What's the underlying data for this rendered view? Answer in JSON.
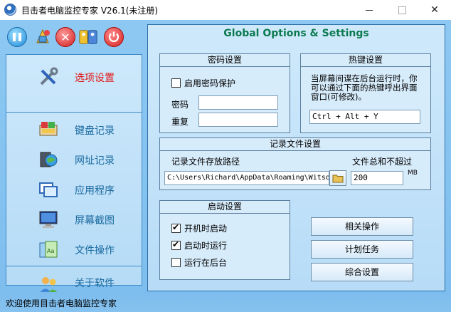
{
  "window": {
    "title": "目击者电脑监控专家 V26.1(未注册)",
    "close_glyph": "✕"
  },
  "toolbar": {
    "buttons": [
      {
        "icon": "pause-icon"
      },
      {
        "icon": "clean-icon"
      },
      {
        "icon": "stop-icon",
        "glyph": "✕"
      },
      {
        "icon": "keys-icon"
      },
      {
        "icon": "power-icon"
      }
    ]
  },
  "sidebar": {
    "items": [
      {
        "label": "选项设置",
        "icon": "tools-icon",
        "active": true
      },
      {
        "label": "键盘记录",
        "icon": "keyboard-icon",
        "active": false
      },
      {
        "label": "网址记录",
        "icon": "globe-icon",
        "active": false
      },
      {
        "label": "应用程序",
        "icon": "windows-icon",
        "active": false
      },
      {
        "label": "屏幕截图",
        "icon": "monitor-icon",
        "active": false
      },
      {
        "label": "文件操作",
        "icon": "files-icon",
        "active": false
      },
      {
        "label": "关于软件",
        "icon": "users-icon",
        "active": false
      }
    ]
  },
  "main": {
    "title": "Global Options & Settings",
    "password": {
      "header": "密码设置",
      "enable_label": "启用密码保护",
      "enable_checked": false,
      "password_label": "密码",
      "password_value": "",
      "repeat_label": "重复",
      "repeat_value": ""
    },
    "hotkey": {
      "header": "热键设置",
      "description": "当屏幕间谍在后台运行时，你可以通过下面的热键呼出界面窗口(可修改)。",
      "value": "Ctrl + Alt + Y"
    },
    "record": {
      "header": "记录文件设置",
      "path_label": "记录文件存放路径",
      "path_value": "C:\\Users\\Richard\\AppData\\Roaming\\Witso",
      "size_label": "文件总和不超过",
      "size_value": "200",
      "size_unit": "MB"
    },
    "startup": {
      "header": "启动设置",
      "options": [
        {
          "label": "开机时启动",
          "checked": true
        },
        {
          "label": "启动时运行",
          "checked": true
        },
        {
          "label": "运行在后台",
          "checked": false
        }
      ]
    },
    "buttons": {
      "related": "相关操作",
      "schedule": "计划任务",
      "general": "综合设置"
    }
  },
  "status": {
    "text": "欢迎使用目击者电脑监控专家"
  }
}
